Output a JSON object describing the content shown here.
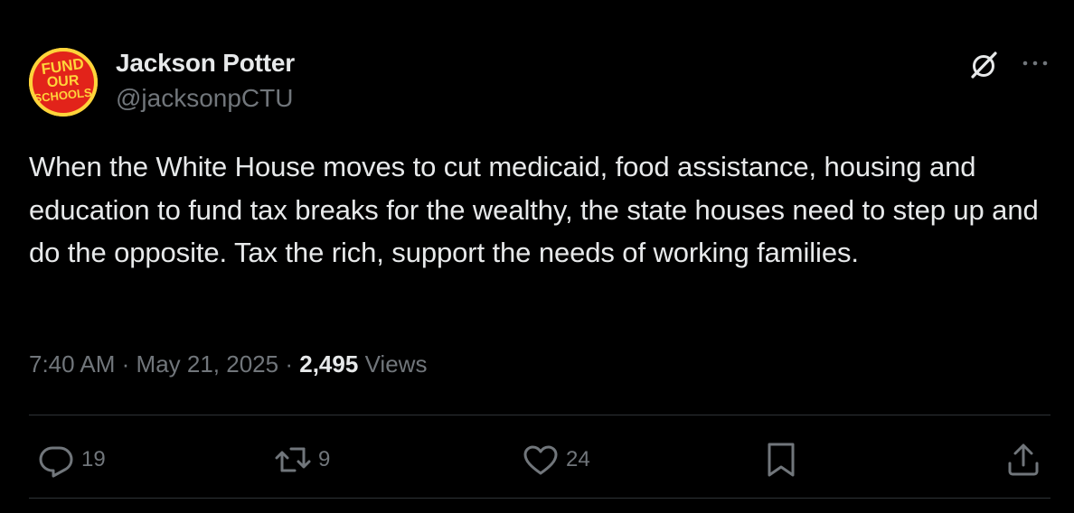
{
  "author": {
    "name": "Jackson Potter",
    "handle": "@jacksonpCTU",
    "avatar_text": [
      "FUND",
      "OUR",
      "SCHOOLS"
    ],
    "avatar_colors": {
      "background": "#ffd43a",
      "circle": "#e2231a",
      "text": "#ffd43a"
    }
  },
  "tweet": {
    "text": "When the White House moves to cut medicaid, food assistance, housing and education to fund tax breaks for the wealthy, the state houses need to step up and do the opposite. Tax the rich, support the needs of working families."
  },
  "meta": {
    "time": "7:40 AM",
    "separator": "·",
    "date": "May 21, 2025",
    "views_count": "2,495",
    "views_label": "Views"
  },
  "actions": {
    "replies": "19",
    "reposts": "9",
    "likes": "24"
  },
  "icons": {
    "grok": "grok-icon",
    "more": "more-icon",
    "reply": "reply-icon",
    "repost": "repost-icon",
    "like": "heart-icon",
    "bookmark": "bookmark-icon",
    "share": "share-icon"
  },
  "colors": {
    "background": "#000000",
    "text_primary": "#e7e9ea",
    "text_secondary": "#71767b",
    "divider": "#2f3336"
  }
}
